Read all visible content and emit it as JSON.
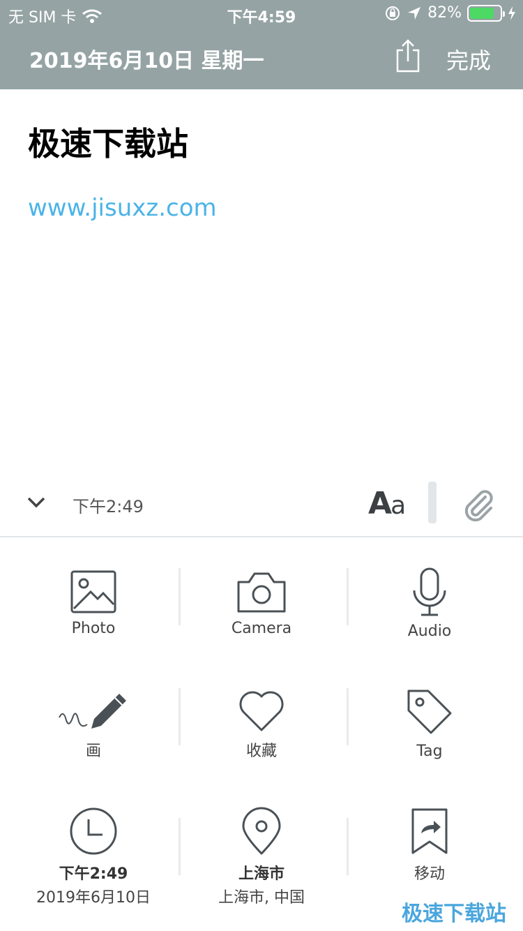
{
  "status_bar": {
    "carrier": "无 SIM 卡",
    "time": "下午4:59",
    "battery_percent": "82%",
    "battery_level": 0.82
  },
  "nav": {
    "date": "2019年6月10日 星期一",
    "done_label": "完成"
  },
  "note": {
    "title": "极速下载站",
    "link": "www.jisuxz.com"
  },
  "toolbar": {
    "time": "下午2:49",
    "font_big": "A",
    "font_small": "a"
  },
  "actions": {
    "photo": "Photo",
    "camera": "Camera",
    "audio": "Audio",
    "draw": "画",
    "favorite": "收藏",
    "tag": "Tag",
    "time_title": "下午2:49",
    "time_date": "2019年6月10日",
    "location_title": "上海市",
    "location_detail": "上海市, 中国",
    "move": "移动"
  },
  "watermark": "极速下载站",
  "colors": {
    "header": "#95a3a4",
    "link": "#4bb3e8",
    "battery": "#4cd964",
    "icon": "#4a5156"
  }
}
